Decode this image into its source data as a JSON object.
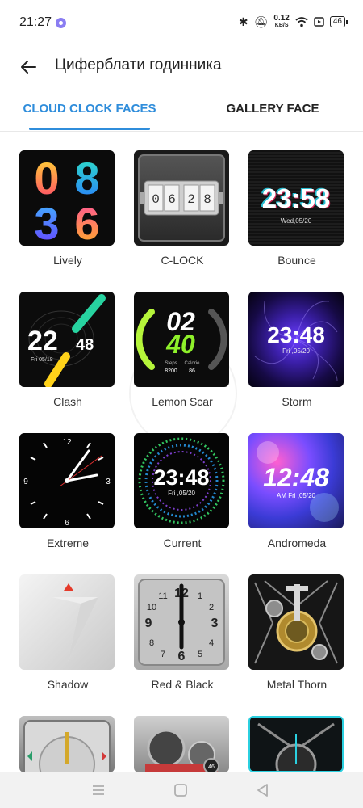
{
  "status_bar": {
    "time": "21:27",
    "net_speed_value": "0.12",
    "net_speed_unit": "KB/S",
    "battery": "46",
    "icons": [
      "assistant-icon",
      "bluetooth-icon",
      "bell-muted-icon",
      "wifi-icon",
      "screen-cast-icon",
      "battery-icon"
    ]
  },
  "header": {
    "back_icon": "back-arrow-icon",
    "title": "Циферблати годинника"
  },
  "tabs": [
    {
      "label": "CLOUD CLOCK FACES",
      "active": true
    },
    {
      "label": "GALLERY FACE",
      "active": false
    }
  ],
  "colors": {
    "accent": "#2f8ddb"
  },
  "faces": {
    "lively": {
      "name": "Lively",
      "digits_top": [
        "0",
        "8"
      ],
      "digits_bottom": [
        "3",
        "6"
      ]
    },
    "clock": {
      "name": "C-LOCK",
      "digits": [
        "0",
        "6",
        "2",
        "8"
      ]
    },
    "bounce": {
      "name": "Bounce",
      "time": "23:58",
      "date": "Wed,05/20"
    },
    "clash": {
      "name": "Clash",
      "hour": "22",
      "minute": "48",
      "date": "Fri 05/18"
    },
    "lemon": {
      "name": "Lemon Scar",
      "hour": "02",
      "minute": "40",
      "steps_label": "Steps",
      "steps_value": "8200",
      "calorie_label": "Calorie",
      "calorie_value": "86"
    },
    "storm": {
      "name": "Storm",
      "time": "23:48",
      "date": "Fri ,05/20"
    },
    "extreme": {
      "name": "Extreme",
      "n12": "12",
      "n3": "3",
      "n6": "6",
      "n9": "9"
    },
    "current": {
      "name": "Current",
      "time": "23:48",
      "date": "Fri ,05/20"
    },
    "andromeda": {
      "name": "Andromeda",
      "time": "12:48",
      "date": "AM Fri ,05/20"
    },
    "shadow": {
      "name": "Shadow"
    },
    "redblack": {
      "name": "Red & Black",
      "n12": "12",
      "n3": "3",
      "n6": "6",
      "n9": "9",
      "n1": "1",
      "n2": "2",
      "n4": "4",
      "n5": "5",
      "n7": "7",
      "n8": "8",
      "n10": "10",
      "n11": "11"
    },
    "metal": {
      "name": "Metal Thorn"
    },
    "row5_badge": "46"
  },
  "nav_bar": {
    "icons": [
      "menu-icon",
      "home-square-icon",
      "back-triangle-icon"
    ]
  }
}
